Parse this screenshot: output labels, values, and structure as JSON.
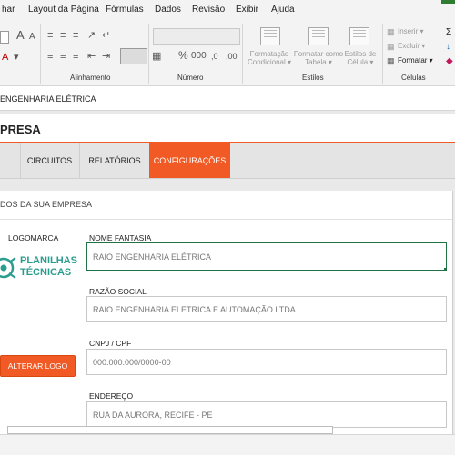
{
  "ribbon": {
    "menu": [
      "har",
      "Layout da Página",
      "Fórmulas",
      "Dados",
      "Revisão",
      "Exibir",
      "Ajuda"
    ],
    "groups": {
      "alinhamento": "Alinhamento",
      "numero": "Número",
      "estilos": "Estilos",
      "celulas": "Células"
    },
    "estilos": {
      "formatacao_condicional": [
        "Formatação",
        "Condicional ▾"
      ],
      "formatar_tabela": [
        "Formatar como",
        "Tabela ▾"
      ],
      "estilos_celula": [
        "Estilos de",
        "Célula ▾"
      ]
    },
    "celulas": {
      "inserir": "Inserir ▾",
      "excluir": "Excluir ▾",
      "formatar": "Formatar ▾"
    }
  },
  "formula_bar": {
    "text": "ENGENHARIA ELÉTRICA"
  },
  "page": {
    "title": "PRESA",
    "tabs": [
      "CIRCUITOS",
      "RELATÓRIOS",
      "CONFIGURAÇÕES"
    ],
    "active_tab": "CONFIGURAÇÕES",
    "section_title": "DOS DA SUA EMPRESA",
    "logo_label": "LOGOMARCA",
    "logo_text": [
      "PLANILHAS",
      "TÉCNICAS"
    ],
    "alter_logo_button": "ALTERAR LOGO",
    "fields": {
      "nome_fantasia": {
        "label": "NOME FANTASIA",
        "value": "RAIO ENGENHARIA ELÉTRICA"
      },
      "razao_social": {
        "label": "RAZÃO SOCIAL",
        "value": "RAIO ENGENHARIA ELETRICA E AUTOMAÇÃO LTDA"
      },
      "cnpj": {
        "label": "CNPJ / CPF",
        "value": "000.000.000/0000-00"
      },
      "endereco": {
        "label": "ENDEREÇO",
        "value": "RUA DA AURORA, RECIFE - PE"
      }
    }
  },
  "colors": {
    "accent": "#f15a24",
    "excel_green": "#217346",
    "logo_teal": "#2a9d8f"
  }
}
